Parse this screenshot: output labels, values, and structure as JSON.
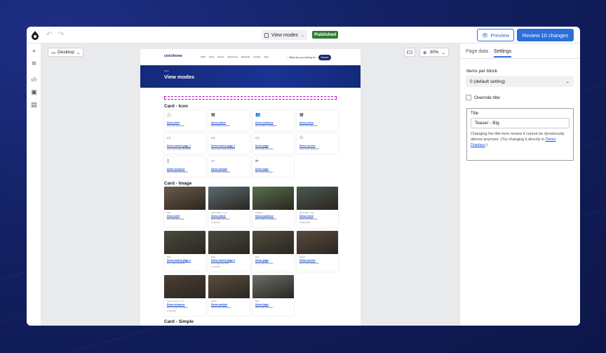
{
  "toolbar": {
    "title": "View modes",
    "status": "Published",
    "preview_label": "Preview",
    "review_label": "Review 10 changes"
  },
  "canvas": {
    "device": "Desktop",
    "zoom": "30%"
  },
  "site": {
    "logo_text": "civictheme",
    "nav": [
      "Work",
      "News",
      "Events",
      "Resources",
      "Meetings",
      "Contact",
      "More"
    ],
    "search_placeholder": "What are you looking for",
    "search_button": "Search",
    "breadcrumb": "Home",
    "page_title": "View modes"
  },
  "sections": {
    "icon": "Card - Icon",
    "image": "Card - Image",
    "simple": "Card - Simple"
  },
  "icon_cards": [
    {
      "icon": "info",
      "title": "Demo alert",
      "desc": "Demo alert description"
    },
    {
      "icon": "article",
      "title": "Demo article",
      "desc": "Demo article description"
    },
    {
      "icon": "people",
      "title": "Demo audience",
      "desc": "Demo audience description"
    },
    {
      "icon": "calendar",
      "title": "Demo event",
      "desc": "Demo event description"
    },
    {
      "icon": "window",
      "title": "Demo search page 1",
      "desc": "Demo search page description"
    },
    {
      "icon": "window",
      "title": "Demo search page 2",
      "desc": "Demo search page description"
    },
    {
      "icon": "window",
      "title": "Demo page",
      "desc": "Demo page description"
    },
    {
      "icon": "user",
      "title": "Demo service",
      "desc": "Demo service description"
    },
    {
      "icon": "document",
      "title": "Demo resource",
      "desc": "Demo resource description"
    },
    {
      "icon": "folder",
      "title": "Demo section",
      "desc": "Demo section description"
    },
    {
      "icon": "tag",
      "title": "Demo topic",
      "desc": "Demo topic description"
    }
  ],
  "image_cards": [
    {
      "meta": "Alert",
      "title": "Demo alert",
      "desc": "Demo alert description",
      "extra": "",
      "color": "#6d5a48"
    },
    {
      "meta": "Demo article · 5 min",
      "title": "Demo article",
      "desc": "Demo article description",
      "extra": "12 Jan 2024",
      "color": "#5c6a70"
    },
    {
      "meta": "Audience",
      "title": "Demo audience",
      "desc": "Demo audience description",
      "extra": "",
      "color": "#56704d"
    },
    {
      "meta": "Demo event · Free",
      "title": "Demo event",
      "desc": "Demo event description",
      "extra": "20 March 2024",
      "color": "#4a5950"
    },
    {
      "meta": "Page",
      "title": "Demo search page 1",
      "desc": "Demo page description",
      "extra": "",
      "color": "#4b4a3d"
    },
    {
      "meta": "Page",
      "title": "Demo search page 2",
      "desc": "Demo page description",
      "extra": "14 Jan 2024",
      "color": "#4a4a3f"
    },
    {
      "meta": "Page",
      "title": "Demo page",
      "desc": "Demo page description",
      "extra": "",
      "color": "#4f4b3d"
    },
    {
      "meta": "Service",
      "title": "Demo service",
      "desc": "Demo service description",
      "extra": "",
      "color": "#5a4b3f"
    },
    {
      "meta": "Demo resource · 1 hr",
      "title": "Demo resource",
      "desc": "Demo resource description",
      "extra": "24 Jan 2024",
      "color": "#4b3f35"
    },
    {
      "meta": "Section",
      "title": "Demo section",
      "desc": "Demo section description",
      "extra": "",
      "color": "#5b4d3f"
    },
    {
      "meta": "Topic",
      "title": "Demo topic",
      "desc": "Demo topic description",
      "extra": "",
      "color": "#6b6d68"
    }
  ],
  "panel": {
    "tabs": [
      "Page data",
      "Settings"
    ],
    "items_label": "Items per block",
    "items_value": "0 (default setting)",
    "override_label": "Override title",
    "title_label": "Title",
    "title_value": "Teaser - Big",
    "help_text": "Changing the title here means it cannot be dynamically altered anymore. (Try changing it directly in ",
    "help_link": "Demo Displays",
    "help_end": ".)"
  },
  "colors": {
    "accent": "#2c6fdb",
    "published": "#2e7d32",
    "hero": "#132a7a"
  }
}
